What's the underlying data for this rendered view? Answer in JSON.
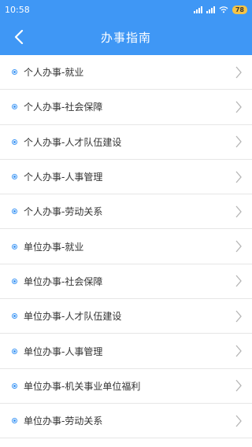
{
  "status_bar": {
    "time": "10:58",
    "battery": "78",
    "icons": [
      "signal-icon",
      "signal-icon",
      "wifi-icon",
      "battery-icon"
    ]
  },
  "nav": {
    "title": "办事指南",
    "back_icon": "chevron-left-icon"
  },
  "list": {
    "items": [
      {
        "label": "个人办事-就业"
      },
      {
        "label": "个人办事-社会保障"
      },
      {
        "label": "个人办事-人才队伍建设"
      },
      {
        "label": "个人办事-人事管理"
      },
      {
        "label": "个人办事-劳动关系"
      },
      {
        "label": "单位办事-就业"
      },
      {
        "label": "单位办事-社会保障"
      },
      {
        "label": "单位办事-人才队伍建设"
      },
      {
        "label": "单位办事-人事管理"
      },
      {
        "label": "单位办事-机关事业单位福利"
      },
      {
        "label": "单位办事-劳动关系"
      }
    ]
  },
  "colors": {
    "accent": "#3f97f5",
    "divider": "#e6e6e6",
    "text": "#333333",
    "chevron": "#b5b5b5"
  }
}
